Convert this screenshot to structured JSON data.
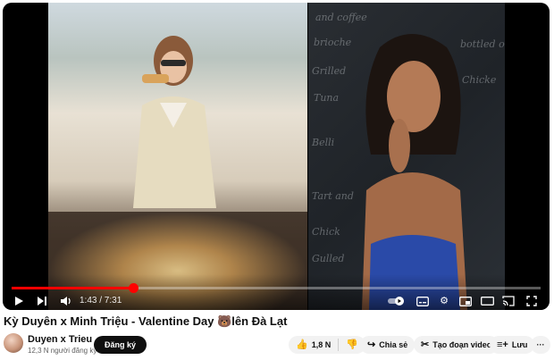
{
  "video": {
    "time_display": "1:43 / 7:31",
    "progress": 0.23,
    "chalk_words": [
      "and coffee",
      "brioche",
      "Grilled",
      "Tuna",
      "Belli",
      "Tart and",
      "Chick",
      "Gulled",
      "bottled o",
      "Chicke"
    ]
  },
  "title": "Kỳ Duyên x Minh Triệu - Valentine Day 🐻lên Đà Lạt",
  "channel": {
    "name": "Duyen x Trieu",
    "subscribers": "12,3 N người đăng ký",
    "subscribe_label": "Đăng ký"
  },
  "actions": {
    "like_count": "1,8 N",
    "share_label": "Chia sẻ",
    "clip_label": "Tạo đoạn video",
    "save_label": "Lưu",
    "more": "···"
  },
  "colors": {
    "accent": "#ff0000",
    "text": "#0f0f0f",
    "secondary": "#606060",
    "pill_bg": "#f2f2f2"
  }
}
